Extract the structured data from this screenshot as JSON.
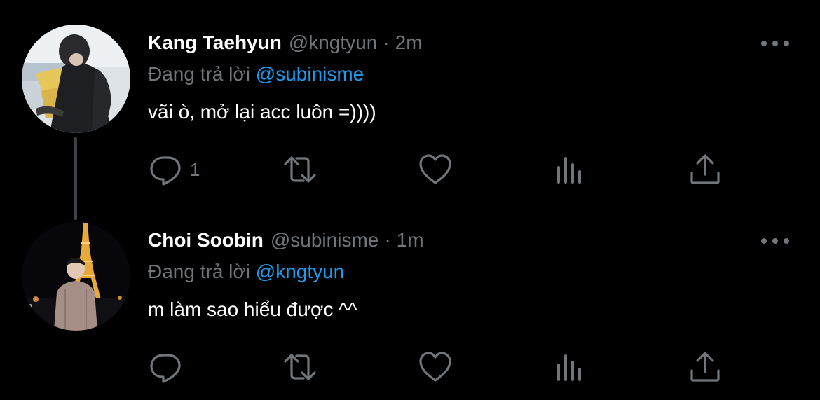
{
  "colors": {
    "background": "#000000",
    "primary_text": "#ffffff",
    "secondary_text": "#71767b",
    "mention": "#1d9bf0",
    "thread_line": "#3e4144"
  },
  "tweets": [
    {
      "display_name": "Kang Taehyun",
      "handle": "@kngtyun",
      "separator": "·",
      "time": "2m",
      "replying_label": "Đang trả lời",
      "replying_to": "@subinisme",
      "text": "vãi ò, mở lại acc luôn =))))",
      "reply_count": "1",
      "icons": [
        "reply-icon",
        "retweet-icon",
        "like-icon",
        "views-icon",
        "share-icon",
        "more-icon"
      ]
    },
    {
      "display_name": "Choi Soobin",
      "handle": "@subinisme",
      "separator": "·",
      "time": "1m",
      "replying_label": "Đang trả lời",
      "replying_to": "@kngtyun",
      "text": "m làm sao hiểu được ^^",
      "reply_count": "",
      "icons": [
        "reply-icon",
        "retweet-icon",
        "like-icon",
        "views-icon",
        "share-icon",
        "more-icon"
      ]
    }
  ]
}
